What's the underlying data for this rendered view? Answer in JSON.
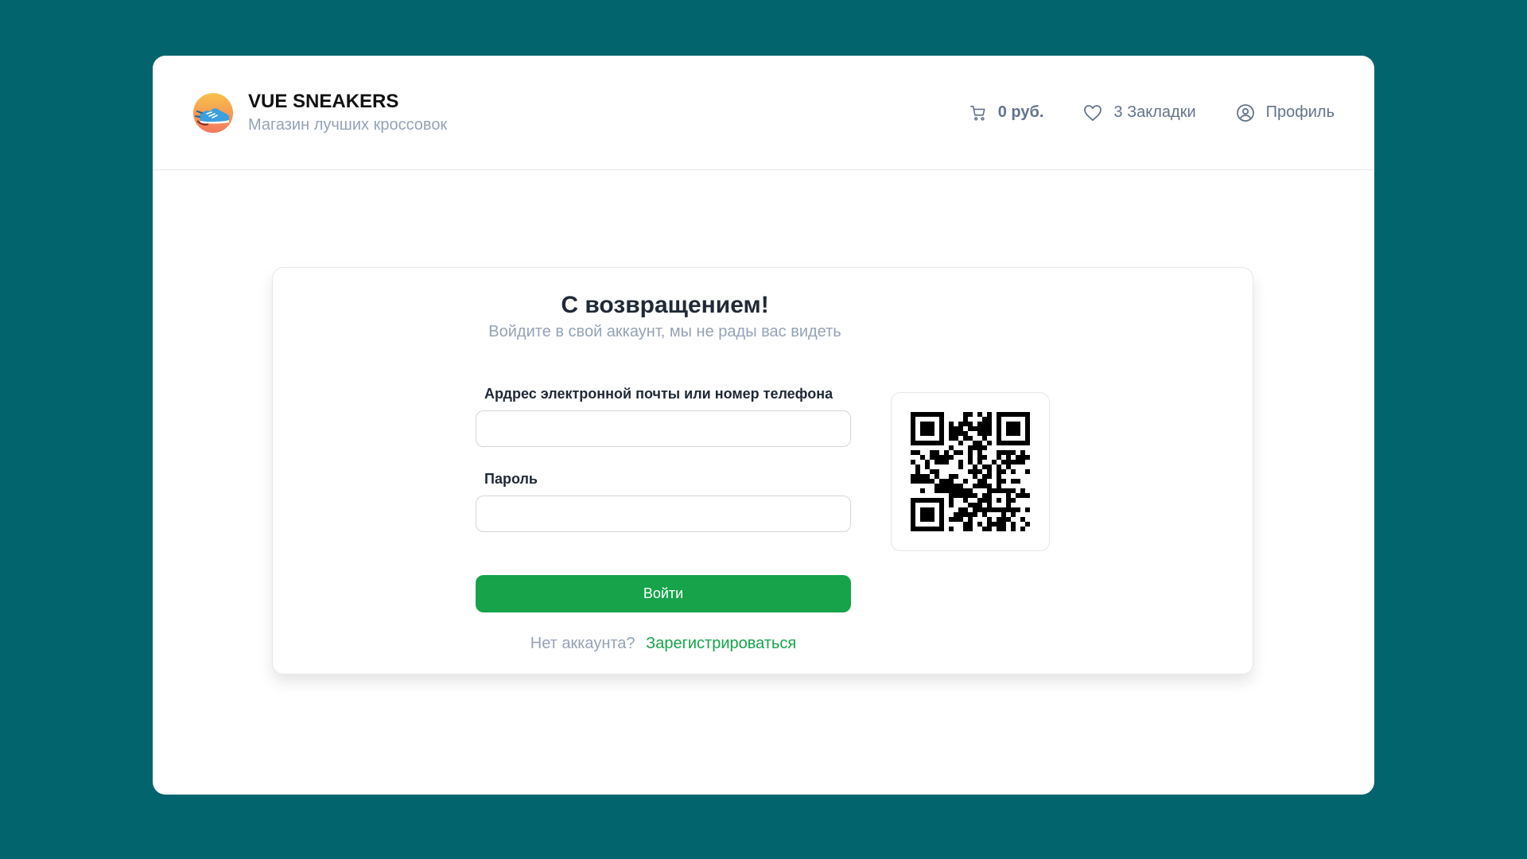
{
  "header": {
    "brand_title": "VUE SNEAKERS",
    "brand_subtitle": "Магазин лучших кроссовок",
    "cart_total": "0 руб.",
    "bookmarks_label": "3 Закладки",
    "profile_label": "Профиль"
  },
  "login": {
    "title": "С возвращением!",
    "subtitle": "Войдите в свой аккаунт, мы не рады вас видеть",
    "email_label": "Ардрес электронной почты или номер телефона",
    "email_value": "",
    "password_label": "Пароль",
    "password_value": "",
    "submit_label": "Войти",
    "register_prompt": "Нет аккаунта?",
    "register_link": "Зарегистрироваться"
  },
  "icons": {
    "cart": "cart-icon",
    "bookmarks": "heart-icon",
    "profile": "user-circle-icon",
    "logo": "sneaker-logo-icon",
    "qr": "qr-code-icon"
  },
  "colors": {
    "page_background": "#02656e",
    "card_background": "#ffffff",
    "accent": "#16a34a",
    "muted_text": "#94a3b8",
    "nav_text": "#64748b"
  }
}
